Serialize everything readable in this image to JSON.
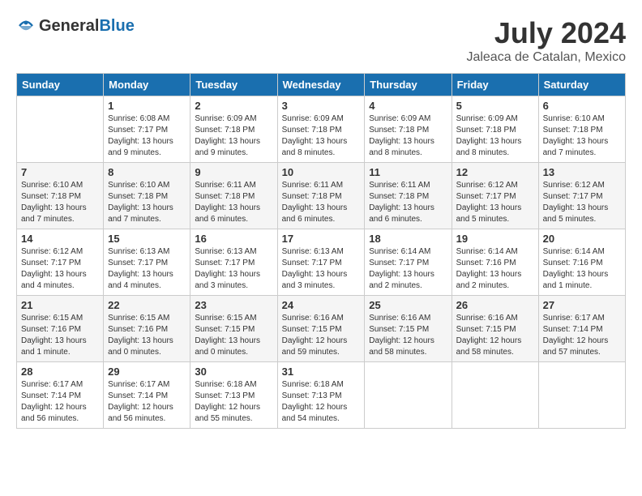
{
  "logo": {
    "text_general": "General",
    "text_blue": "Blue"
  },
  "title": "July 2024",
  "location": "Jaleaca de Catalan, Mexico",
  "days_of_week": [
    "Sunday",
    "Monday",
    "Tuesday",
    "Wednesday",
    "Thursday",
    "Friday",
    "Saturday"
  ],
  "weeks": [
    [
      {
        "day": "",
        "info": ""
      },
      {
        "day": "1",
        "info": "Sunrise: 6:08 AM\nSunset: 7:17 PM\nDaylight: 13 hours\nand 9 minutes."
      },
      {
        "day": "2",
        "info": "Sunrise: 6:09 AM\nSunset: 7:18 PM\nDaylight: 13 hours\nand 9 minutes."
      },
      {
        "day": "3",
        "info": "Sunrise: 6:09 AM\nSunset: 7:18 PM\nDaylight: 13 hours\nand 8 minutes."
      },
      {
        "day": "4",
        "info": "Sunrise: 6:09 AM\nSunset: 7:18 PM\nDaylight: 13 hours\nand 8 minutes."
      },
      {
        "day": "5",
        "info": "Sunrise: 6:09 AM\nSunset: 7:18 PM\nDaylight: 13 hours\nand 8 minutes."
      },
      {
        "day": "6",
        "info": "Sunrise: 6:10 AM\nSunset: 7:18 PM\nDaylight: 13 hours\nand 7 minutes."
      }
    ],
    [
      {
        "day": "7",
        "info": "Sunrise: 6:10 AM\nSunset: 7:18 PM\nDaylight: 13 hours\nand 7 minutes."
      },
      {
        "day": "8",
        "info": "Sunrise: 6:10 AM\nSunset: 7:18 PM\nDaylight: 13 hours\nand 7 minutes."
      },
      {
        "day": "9",
        "info": "Sunrise: 6:11 AM\nSunset: 7:18 PM\nDaylight: 13 hours\nand 6 minutes."
      },
      {
        "day": "10",
        "info": "Sunrise: 6:11 AM\nSunset: 7:18 PM\nDaylight: 13 hours\nand 6 minutes."
      },
      {
        "day": "11",
        "info": "Sunrise: 6:11 AM\nSunset: 7:18 PM\nDaylight: 13 hours\nand 6 minutes."
      },
      {
        "day": "12",
        "info": "Sunrise: 6:12 AM\nSunset: 7:17 PM\nDaylight: 13 hours\nand 5 minutes."
      },
      {
        "day": "13",
        "info": "Sunrise: 6:12 AM\nSunset: 7:17 PM\nDaylight: 13 hours\nand 5 minutes."
      }
    ],
    [
      {
        "day": "14",
        "info": "Sunrise: 6:12 AM\nSunset: 7:17 PM\nDaylight: 13 hours\nand 4 minutes."
      },
      {
        "day": "15",
        "info": "Sunrise: 6:13 AM\nSunset: 7:17 PM\nDaylight: 13 hours\nand 4 minutes."
      },
      {
        "day": "16",
        "info": "Sunrise: 6:13 AM\nSunset: 7:17 PM\nDaylight: 13 hours\nand 3 minutes."
      },
      {
        "day": "17",
        "info": "Sunrise: 6:13 AM\nSunset: 7:17 PM\nDaylight: 13 hours\nand 3 minutes."
      },
      {
        "day": "18",
        "info": "Sunrise: 6:14 AM\nSunset: 7:17 PM\nDaylight: 13 hours\nand 2 minutes."
      },
      {
        "day": "19",
        "info": "Sunrise: 6:14 AM\nSunset: 7:16 PM\nDaylight: 13 hours\nand 2 minutes."
      },
      {
        "day": "20",
        "info": "Sunrise: 6:14 AM\nSunset: 7:16 PM\nDaylight: 13 hours\nand 1 minute."
      }
    ],
    [
      {
        "day": "21",
        "info": "Sunrise: 6:15 AM\nSunset: 7:16 PM\nDaylight: 13 hours\nand 1 minute."
      },
      {
        "day": "22",
        "info": "Sunrise: 6:15 AM\nSunset: 7:16 PM\nDaylight: 13 hours\nand 0 minutes."
      },
      {
        "day": "23",
        "info": "Sunrise: 6:15 AM\nSunset: 7:15 PM\nDaylight: 13 hours\nand 0 minutes."
      },
      {
        "day": "24",
        "info": "Sunrise: 6:16 AM\nSunset: 7:15 PM\nDaylight: 12 hours\nand 59 minutes."
      },
      {
        "day": "25",
        "info": "Sunrise: 6:16 AM\nSunset: 7:15 PM\nDaylight: 12 hours\nand 58 minutes."
      },
      {
        "day": "26",
        "info": "Sunrise: 6:16 AM\nSunset: 7:15 PM\nDaylight: 12 hours\nand 58 minutes."
      },
      {
        "day": "27",
        "info": "Sunrise: 6:17 AM\nSunset: 7:14 PM\nDaylight: 12 hours\nand 57 minutes."
      }
    ],
    [
      {
        "day": "28",
        "info": "Sunrise: 6:17 AM\nSunset: 7:14 PM\nDaylight: 12 hours\nand 56 minutes."
      },
      {
        "day": "29",
        "info": "Sunrise: 6:17 AM\nSunset: 7:14 PM\nDaylight: 12 hours\nand 56 minutes."
      },
      {
        "day": "30",
        "info": "Sunrise: 6:18 AM\nSunset: 7:13 PM\nDaylight: 12 hours\nand 55 minutes."
      },
      {
        "day": "31",
        "info": "Sunrise: 6:18 AM\nSunset: 7:13 PM\nDaylight: 12 hours\nand 54 minutes."
      },
      {
        "day": "",
        "info": ""
      },
      {
        "day": "",
        "info": ""
      },
      {
        "day": "",
        "info": ""
      }
    ]
  ]
}
